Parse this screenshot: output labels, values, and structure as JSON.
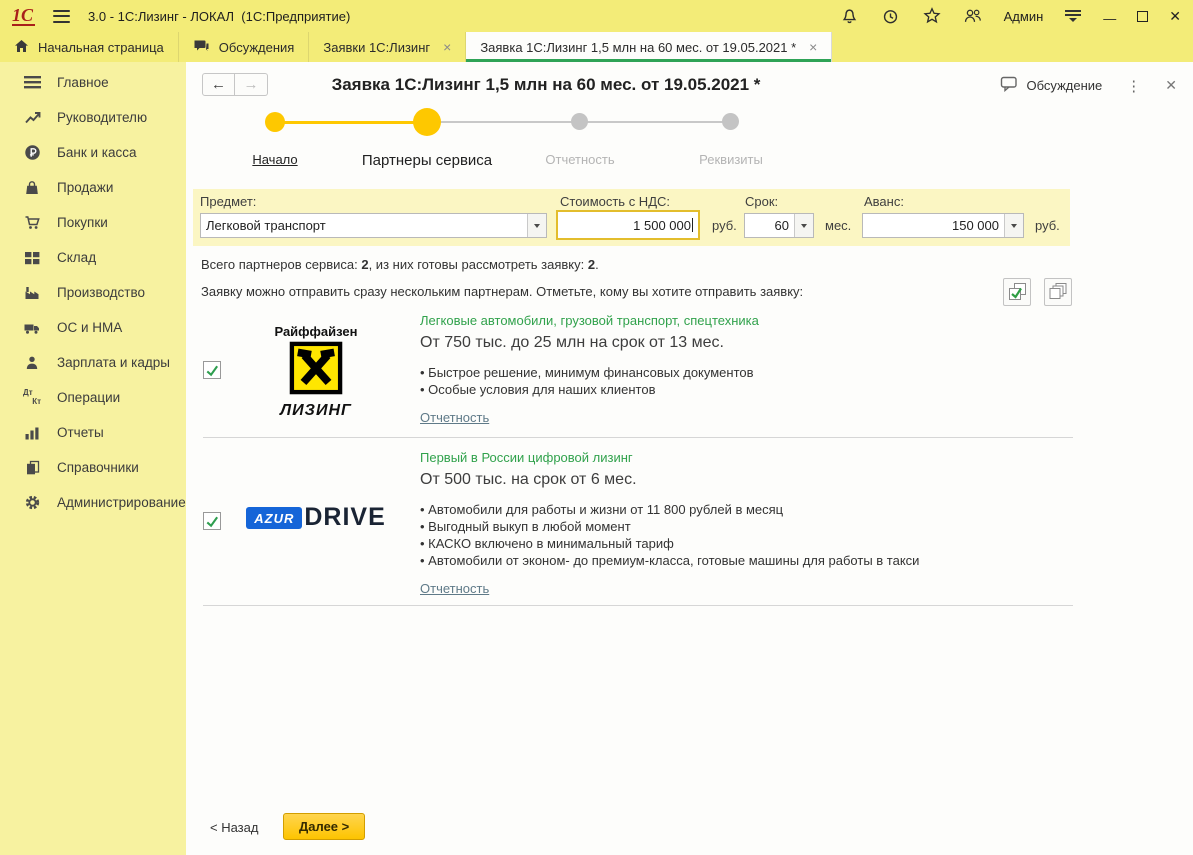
{
  "titlebar": {
    "logo": "1С",
    "app_title": "3.0 - 1С:Лизинг - ЛОКАЛ  (1С:Предприятие)",
    "user": "Админ"
  },
  "tabs": {
    "home": "Начальная страница",
    "discussions": "Обсуждения",
    "requests_list": "Заявки 1С:Лизинг",
    "request_active": "Заявка 1С:Лизинг 1,5 млн на 60 мес. от 19.05.2021 *"
  },
  "sidebar": {
    "items": [
      {
        "label": "Главное"
      },
      {
        "label": "Руководителю"
      },
      {
        "label": "Банк и касса"
      },
      {
        "label": "Продажи"
      },
      {
        "label": "Покупки"
      },
      {
        "label": "Склад"
      },
      {
        "label": "Производство"
      },
      {
        "label": "ОС и НМА"
      },
      {
        "label": "Зарплата и кадры"
      },
      {
        "label": "Операции",
        "icon_top": "Дт",
        "icon_bottom": "Кт"
      },
      {
        "label": "Отчеты"
      },
      {
        "label": "Справочники"
      },
      {
        "label": "Администрирование"
      }
    ]
  },
  "header": {
    "title": "Заявка 1С:Лизинг 1,5 млн на 60 мес. от 19.05.2021 *",
    "discussion_label": "Обсуждение"
  },
  "steps": [
    {
      "label": "Начало"
    },
    {
      "label": "Партнеры сервиса"
    },
    {
      "label": "Отчетность"
    },
    {
      "label": "Реквизиты"
    }
  ],
  "form": {
    "subject_label": "Предмет:",
    "subject_value": "Легковой транспорт",
    "cost_label": "Стоимость с НДС:",
    "cost_value": "1 500 000",
    "cost_unit": "руб.",
    "term_label": "Срок:",
    "term_value": "60",
    "term_unit": "мес.",
    "advance_label": "Аванс:",
    "advance_value": "150 000",
    "advance_unit": "руб."
  },
  "summary": {
    "part1": "Всего партнеров сервиса: ",
    "count1": "2",
    "part2": ", из них готовы рассмотреть заявку: ",
    "count2": "2",
    "part3": "."
  },
  "instruction": "Заявку можно отправить сразу нескольким партнерам. Отметьте, кому вы хотите отправить заявку:",
  "partners": [
    {
      "brand_top": "Райффайзен",
      "brand_bottom": "ЛИЗИНГ",
      "tagline": "Легковые автомобили, грузовой транспорт, спецтехника",
      "offer": "От 750 тыс. до 25 млн на срок от 13 мес.",
      "bullets": [
        "Быстрое решение, минимум финансовых документов",
        "Особые условия для наших клиентов"
      ],
      "report_link": "Отчетность"
    },
    {
      "brand_left": "AZUR",
      "brand_right": "DRIVE",
      "tagline": "Первый в России цифровой лизинг",
      "offer": "От 500 тыс. на срок от 6 мес.",
      "bullets": [
        "Автомобили для работы и жизни от 11 800 рублей в месяц",
        "Выгодный выкуп в любой момент",
        "КАСКО включено в минимальный тариф",
        "Автомобили от эконом- до премиум-класса, готовые машины для работы в такси"
      ],
      "report_link": "Отчетность"
    }
  ],
  "footer": {
    "back_label": "< Назад",
    "next_label": "Далее >"
  },
  "icons": {
    "tab_close": "×",
    "kebab": "⋮",
    "form_close": "✕",
    "window_close": "✕",
    "minimize": "—",
    "back_arrow": "←",
    "forward_arrow": "→"
  },
  "colors": {
    "titlebar_yellow": "#f3ec78",
    "sidebar_yellow": "#f7f2a0",
    "band_yellow": "#fbf6c3",
    "accent_yellow": "#fec800",
    "tab_green": "#2fa356",
    "tagline_green": "#31a24c",
    "azur_blue": "#1565d8",
    "raiffeisen_yellow": "#ffe600"
  }
}
